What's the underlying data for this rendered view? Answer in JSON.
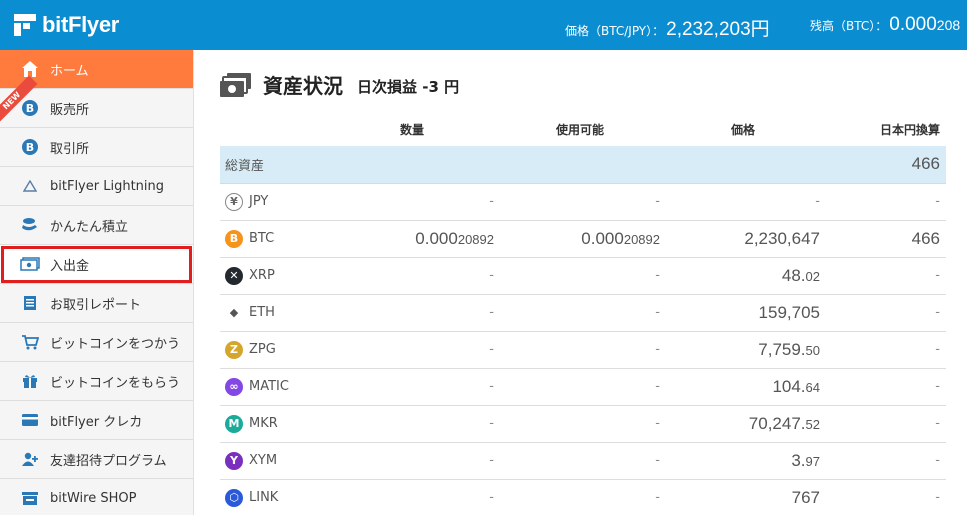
{
  "header": {
    "logo_text": "bitFlyer",
    "price_label": "価格（BTC/JPY）：",
    "price_value": "2,232,203円",
    "balance_label": "残高（BTC）：",
    "balance_main": "0.000",
    "balance_small": "208",
    "bg_color": "#0b8dd2"
  },
  "sidebar": {
    "items": [
      {
        "label": "ホーム",
        "icon": "home-icon"
      },
      {
        "label": "販売所",
        "icon": "bitcoin-icon",
        "badge": "NEW"
      },
      {
        "label": "取引所",
        "icon": "bitcoin-icon"
      },
      {
        "label": "bitFlyer Lightning",
        "icon": "lightning-triangle-icon"
      },
      {
        "label": "かんたん積立",
        "icon": "coin-stack-icon"
      },
      {
        "label": "入出金",
        "icon": "cash-icon"
      },
      {
        "label": "お取引レポート",
        "icon": "report-icon"
      },
      {
        "label": "ビットコインをつかう",
        "icon": "cart-icon"
      },
      {
        "label": "ビットコインをもらう",
        "icon": "gift-icon"
      },
      {
        "label": "bitFlyer クレカ",
        "icon": "credit-card-icon"
      },
      {
        "label": "友達招待プログラム",
        "icon": "invite-icon"
      },
      {
        "label": "bitWire SHOP",
        "icon": "shop-icon"
      }
    ],
    "active_color": "#ff7a3d",
    "highlight_color": "#e01e1e"
  },
  "main": {
    "title": "資産状況",
    "daily_pnl": "日次損益 -3 円",
    "columns": [
      "数量",
      "使用可能",
      "価格",
      "日本円換算"
    ],
    "total": {
      "label": "総資産",
      "jpy": "466"
    },
    "rows": [
      {
        "coin": "JPY",
        "qty": "-",
        "avail": "-",
        "price": "-",
        "price_small": "",
        "jpy": "-"
      },
      {
        "coin": "BTC",
        "qty": "0.000",
        "qty_small": "20892",
        "avail": "0.000",
        "avail_small": "20892",
        "price": "2,230,647",
        "price_small": "",
        "jpy": "466"
      },
      {
        "coin": "XRP",
        "qty": "-",
        "avail": "-",
        "price": "48.",
        "price_small": "02",
        "jpy": "-"
      },
      {
        "coin": "ETH",
        "qty": "-",
        "avail": "-",
        "price": "159,705",
        "price_small": "",
        "jpy": "-"
      },
      {
        "coin": "ZPG",
        "qty": "-",
        "avail": "-",
        "price": "7,759.",
        "price_small": "50",
        "jpy": "-"
      },
      {
        "coin": "MATIC",
        "qty": "-",
        "avail": "-",
        "price": "104.",
        "price_small": "64",
        "jpy": "-"
      },
      {
        "coin": "MKR",
        "qty": "-",
        "avail": "-",
        "price": "70,247.",
        "price_small": "52",
        "jpy": "-"
      },
      {
        "coin": "XYM",
        "qty": "-",
        "avail": "-",
        "price": "3.",
        "price_small": "97",
        "jpy": "-"
      },
      {
        "coin": "LINK",
        "qty": "-",
        "avail": "-",
        "price": "767",
        "price_small": "",
        "jpy": "-"
      }
    ],
    "total_row_color": "#d7ecf6"
  }
}
